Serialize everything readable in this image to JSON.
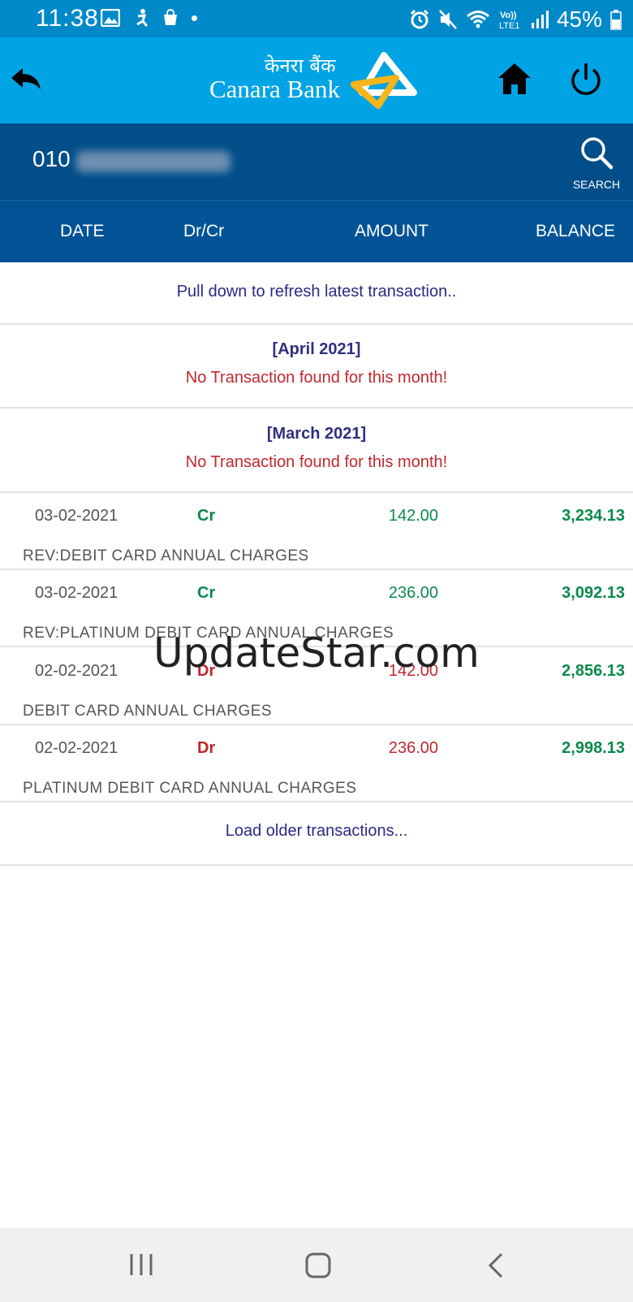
{
  "status_bar": {
    "time": "11:38",
    "battery_percent": "45%",
    "network": "LTE1",
    "left_icons": [
      "gallery-icon",
      "accessibility-icon",
      "shopping-bag-icon",
      "dot-icon"
    ],
    "right_icons": [
      "alarm-icon",
      "mute-icon",
      "wifi-icon",
      "volte-icon",
      "signal-icon",
      "battery-icon"
    ]
  },
  "header": {
    "bank_name_hindi": "केनरा बैंक",
    "bank_name": "Canara Bank"
  },
  "account": {
    "number_visible": "010",
    "search_label": "SEARCH"
  },
  "columns": {
    "date": "DATE",
    "drcr": "Dr/Cr",
    "amount": "AMOUNT",
    "balance": "BALANCE"
  },
  "refresh_hint": "Pull down to refresh latest transaction..",
  "months": [
    {
      "label": "[April 2021]",
      "message": "No Transaction found for this month!"
    },
    {
      "label": "[March 2021]",
      "message": "No Transaction found for this month!"
    }
  ],
  "transactions": [
    {
      "date": "03-02-2021",
      "type": "Cr",
      "amount": "142.00",
      "balance": "3,234.13",
      "description": "REV:DEBIT CARD ANNUAL CHARGES"
    },
    {
      "date": "03-02-2021",
      "type": "Cr",
      "amount": "236.00",
      "balance": "3,092.13",
      "description": "REV:PLATINUM DEBIT CARD ANNUAL CHARGES"
    },
    {
      "date": "02-02-2021",
      "type": "Dr",
      "amount": "142.00",
      "balance": "2,856.13",
      "description": "DEBIT CARD ANNUAL CHARGES"
    },
    {
      "date": "02-02-2021",
      "type": "Dr",
      "amount": "236.00",
      "balance": "2,998.13",
      "description": "PLATINUM DEBIT CARD ANNUAL CHARGES"
    }
  ],
  "load_older": "Load older transactions...",
  "watermark": "UpdateStar.com",
  "colors": {
    "status_bar": "#0089c9",
    "app_bar": "#00a4e4",
    "account_bar": "#014e8a",
    "credit": "#0b8a4c",
    "debit": "#c0282e",
    "link": "#2a2a86"
  }
}
